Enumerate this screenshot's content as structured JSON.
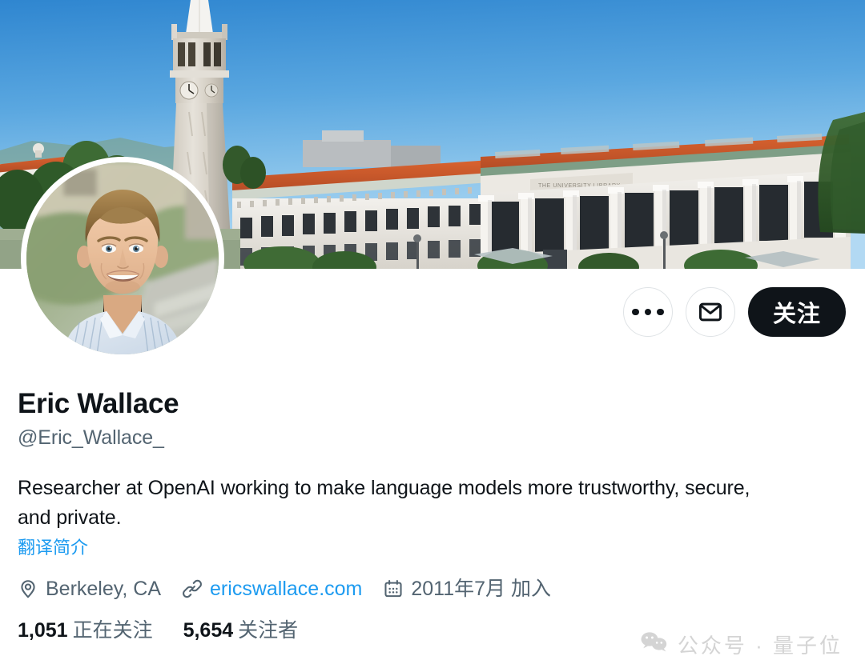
{
  "banner": {
    "alt": "UC Berkeley Campanile tower and Doe Library under clear blue sky",
    "library_inscription": "THE UNIVERSITY LIBRARY"
  },
  "avatar": {
    "alt": "Portrait of a smiling man with blond hair wearing a light blue striped shirt"
  },
  "actions": {
    "more_label": "",
    "message_label": "",
    "follow_label": "关注"
  },
  "profile": {
    "display_name": "Eric Wallace",
    "handle": "@Eric_Wallace_",
    "bio": "Researcher at OpenAI working to make language models more trustworthy, secure, and private.",
    "translate_label": "翻译简介"
  },
  "meta": {
    "location": "Berkeley, CA",
    "website": "ericswallace.com",
    "joined": "2011年7月 加入"
  },
  "stats": {
    "following_count": "1,051",
    "following_label": "正在关注",
    "followers_count": "5,654",
    "followers_label": "关注者"
  },
  "watermark": {
    "text": "公众号 · 量子位"
  },
  "colors": {
    "accent_blue": "#1d9bf0",
    "text_primary": "#0f1419",
    "text_secondary": "#536471",
    "follow_bg": "#0f1419",
    "border": "#dfe3e6"
  }
}
